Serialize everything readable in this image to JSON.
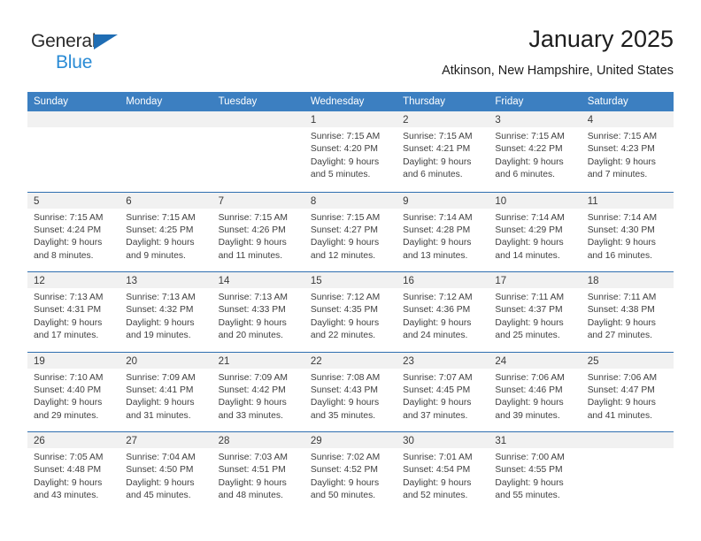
{
  "brand": {
    "line1": "General",
    "line2": "Blue",
    "accent_color": "#2a8bd5",
    "triangle_color": "#1f6db4"
  },
  "header": {
    "title": "January 2025",
    "subtitle": "Atkinson, New Hampshire, United States"
  },
  "calendar": {
    "header_bg": "#3c7fc1",
    "row_divider": "#2f6fb0",
    "daynum_bg": "#f1f1f1",
    "weekday_headers": [
      "Sunday",
      "Monday",
      "Tuesday",
      "Wednesday",
      "Thursday",
      "Friday",
      "Saturday"
    ],
    "weeks": [
      [
        {
          "day": "",
          "lines": []
        },
        {
          "day": "",
          "lines": []
        },
        {
          "day": "",
          "lines": []
        },
        {
          "day": "1",
          "lines": [
            "Sunrise: 7:15 AM",
            "Sunset: 4:20 PM",
            "Daylight: 9 hours",
            "and 5 minutes."
          ]
        },
        {
          "day": "2",
          "lines": [
            "Sunrise: 7:15 AM",
            "Sunset: 4:21 PM",
            "Daylight: 9 hours",
            "and 6 minutes."
          ]
        },
        {
          "day": "3",
          "lines": [
            "Sunrise: 7:15 AM",
            "Sunset: 4:22 PM",
            "Daylight: 9 hours",
            "and 6 minutes."
          ]
        },
        {
          "day": "4",
          "lines": [
            "Sunrise: 7:15 AM",
            "Sunset: 4:23 PM",
            "Daylight: 9 hours",
            "and 7 minutes."
          ]
        }
      ],
      [
        {
          "day": "5",
          "lines": [
            "Sunrise: 7:15 AM",
            "Sunset: 4:24 PM",
            "Daylight: 9 hours",
            "and 8 minutes."
          ]
        },
        {
          "day": "6",
          "lines": [
            "Sunrise: 7:15 AM",
            "Sunset: 4:25 PM",
            "Daylight: 9 hours",
            "and 9 minutes."
          ]
        },
        {
          "day": "7",
          "lines": [
            "Sunrise: 7:15 AM",
            "Sunset: 4:26 PM",
            "Daylight: 9 hours",
            "and 11 minutes."
          ]
        },
        {
          "day": "8",
          "lines": [
            "Sunrise: 7:15 AM",
            "Sunset: 4:27 PM",
            "Daylight: 9 hours",
            "and 12 minutes."
          ]
        },
        {
          "day": "9",
          "lines": [
            "Sunrise: 7:14 AM",
            "Sunset: 4:28 PM",
            "Daylight: 9 hours",
            "and 13 minutes."
          ]
        },
        {
          "day": "10",
          "lines": [
            "Sunrise: 7:14 AM",
            "Sunset: 4:29 PM",
            "Daylight: 9 hours",
            "and 14 minutes."
          ]
        },
        {
          "day": "11",
          "lines": [
            "Sunrise: 7:14 AM",
            "Sunset: 4:30 PM",
            "Daylight: 9 hours",
            "and 16 minutes."
          ]
        }
      ],
      [
        {
          "day": "12",
          "lines": [
            "Sunrise: 7:13 AM",
            "Sunset: 4:31 PM",
            "Daylight: 9 hours",
            "and 17 minutes."
          ]
        },
        {
          "day": "13",
          "lines": [
            "Sunrise: 7:13 AM",
            "Sunset: 4:32 PM",
            "Daylight: 9 hours",
            "and 19 minutes."
          ]
        },
        {
          "day": "14",
          "lines": [
            "Sunrise: 7:13 AM",
            "Sunset: 4:33 PM",
            "Daylight: 9 hours",
            "and 20 minutes."
          ]
        },
        {
          "day": "15",
          "lines": [
            "Sunrise: 7:12 AM",
            "Sunset: 4:35 PM",
            "Daylight: 9 hours",
            "and 22 minutes."
          ]
        },
        {
          "day": "16",
          "lines": [
            "Sunrise: 7:12 AM",
            "Sunset: 4:36 PM",
            "Daylight: 9 hours",
            "and 24 minutes."
          ]
        },
        {
          "day": "17",
          "lines": [
            "Sunrise: 7:11 AM",
            "Sunset: 4:37 PM",
            "Daylight: 9 hours",
            "and 25 minutes."
          ]
        },
        {
          "day": "18",
          "lines": [
            "Sunrise: 7:11 AM",
            "Sunset: 4:38 PM",
            "Daylight: 9 hours",
            "and 27 minutes."
          ]
        }
      ],
      [
        {
          "day": "19",
          "lines": [
            "Sunrise: 7:10 AM",
            "Sunset: 4:40 PM",
            "Daylight: 9 hours",
            "and 29 minutes."
          ]
        },
        {
          "day": "20",
          "lines": [
            "Sunrise: 7:09 AM",
            "Sunset: 4:41 PM",
            "Daylight: 9 hours",
            "and 31 minutes."
          ]
        },
        {
          "day": "21",
          "lines": [
            "Sunrise: 7:09 AM",
            "Sunset: 4:42 PM",
            "Daylight: 9 hours",
            "and 33 minutes."
          ]
        },
        {
          "day": "22",
          "lines": [
            "Sunrise: 7:08 AM",
            "Sunset: 4:43 PM",
            "Daylight: 9 hours",
            "and 35 minutes."
          ]
        },
        {
          "day": "23",
          "lines": [
            "Sunrise: 7:07 AM",
            "Sunset: 4:45 PM",
            "Daylight: 9 hours",
            "and 37 minutes."
          ]
        },
        {
          "day": "24",
          "lines": [
            "Sunrise: 7:06 AM",
            "Sunset: 4:46 PM",
            "Daylight: 9 hours",
            "and 39 minutes."
          ]
        },
        {
          "day": "25",
          "lines": [
            "Sunrise: 7:06 AM",
            "Sunset: 4:47 PM",
            "Daylight: 9 hours",
            "and 41 minutes."
          ]
        }
      ],
      [
        {
          "day": "26",
          "lines": [
            "Sunrise: 7:05 AM",
            "Sunset: 4:48 PM",
            "Daylight: 9 hours",
            "and 43 minutes."
          ]
        },
        {
          "day": "27",
          "lines": [
            "Sunrise: 7:04 AM",
            "Sunset: 4:50 PM",
            "Daylight: 9 hours",
            "and 45 minutes."
          ]
        },
        {
          "day": "28",
          "lines": [
            "Sunrise: 7:03 AM",
            "Sunset: 4:51 PM",
            "Daylight: 9 hours",
            "and 48 minutes."
          ]
        },
        {
          "day": "29",
          "lines": [
            "Sunrise: 7:02 AM",
            "Sunset: 4:52 PM",
            "Daylight: 9 hours",
            "and 50 minutes."
          ]
        },
        {
          "day": "30",
          "lines": [
            "Sunrise: 7:01 AM",
            "Sunset: 4:54 PM",
            "Daylight: 9 hours",
            "and 52 minutes."
          ]
        },
        {
          "day": "31",
          "lines": [
            "Sunrise: 7:00 AM",
            "Sunset: 4:55 PM",
            "Daylight: 9 hours",
            "and 55 minutes."
          ]
        },
        {
          "day": "",
          "lines": []
        }
      ]
    ]
  }
}
